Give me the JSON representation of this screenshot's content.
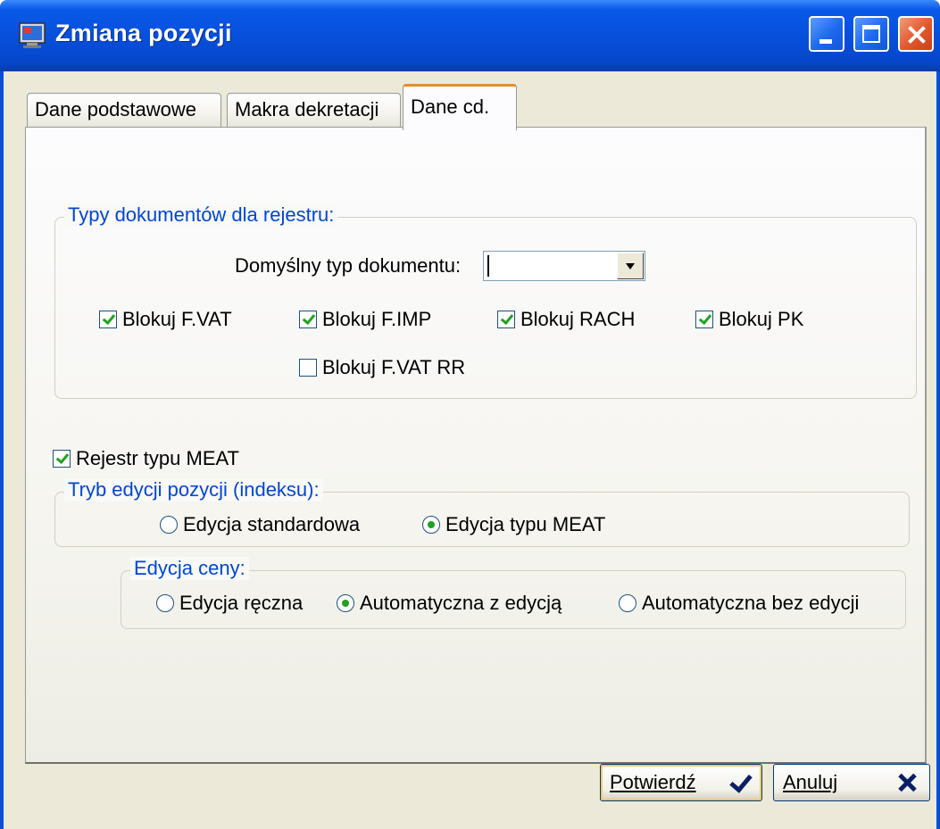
{
  "window": {
    "title": "Zmiana pozycji"
  },
  "tabs": [
    {
      "label": "Dane podstawowe",
      "active": false
    },
    {
      "label": "Makra dekretacji",
      "active": false
    },
    {
      "label": "Dane cd.",
      "active": true
    }
  ],
  "document_types": {
    "group_title": "Typy dokumentów dla rejestru:",
    "default_type_label": "Domyślny typ dokumentu:",
    "default_type_value": "",
    "checkboxes": [
      {
        "label": "Blokuj F.VAT",
        "checked": true
      },
      {
        "label": "Blokuj F.IMP",
        "checked": true
      },
      {
        "label": "Blokuj RACH",
        "checked": true
      },
      {
        "label": "Blokuj PK",
        "checked": true
      },
      {
        "label": "Blokuj F.VAT RR",
        "checked": false
      }
    ]
  },
  "meat_register": {
    "label": "Rejestr typu MEAT",
    "checked": true
  },
  "edit_mode": {
    "group_title": "Tryb edycji pozycji (indeksu):",
    "options": [
      {
        "label": "Edycja standardowa",
        "selected": false
      },
      {
        "label": "Edycja typu MEAT",
        "selected": true
      }
    ]
  },
  "price_edit": {
    "group_title": "Edycja ceny:",
    "options": [
      {
        "label": "Edycja ręczna",
        "selected": false
      },
      {
        "label": "Automatyczna z edycją",
        "selected": true
      },
      {
        "label": "Automatyczna bez edycji",
        "selected": false
      }
    ]
  },
  "buttons": {
    "confirm": "Potwierdź",
    "cancel": "Anuluj"
  },
  "colors": {
    "titlebar": "#0750dc",
    "group_title": "#0046d5",
    "check_mark": "#21a121",
    "active_tab_accent": "#e68b2c"
  }
}
